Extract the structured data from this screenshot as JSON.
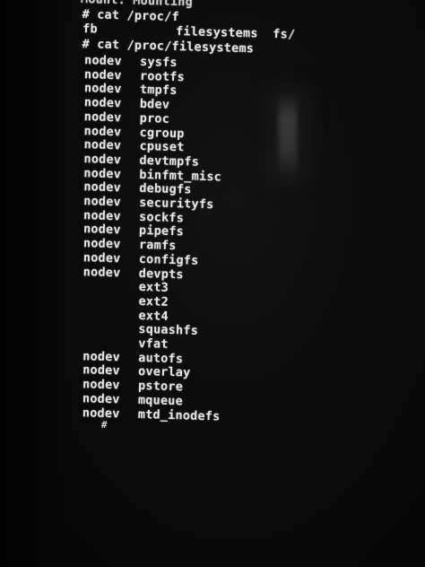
{
  "terminal": {
    "truncated_top": "Mount: Mounting",
    "cmd1": "# cat /proc/f",
    "completion_col1": "fb",
    "completion_col2": "filesystems  fs/",
    "cmd2": "# cat /proc/filesystems",
    "filesystems": [
      {
        "flag": "nodev",
        "name": "sysfs"
      },
      {
        "flag": "nodev",
        "name": "rootfs"
      },
      {
        "flag": "nodev",
        "name": "tmpfs"
      },
      {
        "flag": "nodev",
        "name": "bdev"
      },
      {
        "flag": "nodev",
        "name": "proc"
      },
      {
        "flag": "nodev",
        "name": "cgroup"
      },
      {
        "flag": "nodev",
        "name": "cpuset"
      },
      {
        "flag": "nodev",
        "name": "devtmpfs"
      },
      {
        "flag": "nodev",
        "name": "binfmt_misc"
      },
      {
        "flag": "nodev",
        "name": "debugfs"
      },
      {
        "flag": "nodev",
        "name": "securityfs"
      },
      {
        "flag": "nodev",
        "name": "sockfs"
      },
      {
        "flag": "nodev",
        "name": "pipefs"
      },
      {
        "flag": "nodev",
        "name": "ramfs"
      },
      {
        "flag": "nodev",
        "name": "configfs"
      },
      {
        "flag": "nodev",
        "name": "devpts"
      },
      {
        "flag": "",
        "name": "ext3"
      },
      {
        "flag": "",
        "name": "ext2"
      },
      {
        "flag": "",
        "name": "ext4"
      },
      {
        "flag": "",
        "name": "squashfs"
      },
      {
        "flag": "",
        "name": "vfat"
      },
      {
        "flag": "nodev",
        "name": "autofs"
      },
      {
        "flag": "nodev",
        "name": "overlay"
      },
      {
        "flag": "nodev",
        "name": "pstore"
      },
      {
        "flag": "nodev",
        "name": "mqueue"
      },
      {
        "flag": "nodev",
        "name": "mtd_inodefs"
      }
    ],
    "prompt": "#"
  }
}
